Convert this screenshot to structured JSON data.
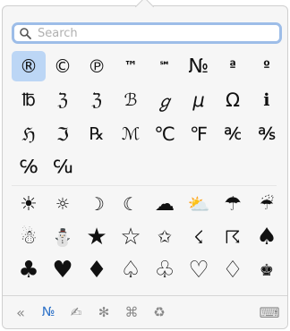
{
  "search": {
    "placeholder": "Search"
  },
  "rows": [
    [
      "®",
      "©",
      "℗",
      "™",
      "℠",
      "№",
      "ª",
      "º"
    ],
    [
      "℔",
      "ℨ",
      "ℨ",
      "ℬ",
      "ℊ",
      "μ",
      "Ω",
      "ℹ"
    ],
    [
      "ℌ",
      "ℑ",
      "℞",
      "ℳ",
      "℃",
      "℉",
      "℀",
      "℁"
    ],
    [
      "℅",
      "℆"
    ]
  ],
  "emoji_rows": [
    [
      "☀",
      "☼",
      "☽",
      "☾",
      "☁",
      "⛅",
      "☂",
      "☔"
    ],
    [
      "☃",
      "⛄",
      "★",
      "☆",
      "✩",
      "☇",
      "☈",
      "♠"
    ],
    [
      "♣",
      "♥",
      "♦",
      "♤",
      "♧",
      "♡",
      "♢",
      "♚"
    ]
  ],
  "clipped_row": [
    "♛",
    "♜",
    "♝",
    "♞",
    "♟",
    "♔",
    "♕",
    "♖"
  ],
  "selected_symbol": "®",
  "bottombar": {
    "back": "«",
    "letterlike": "№",
    "pencil": "✍",
    "asterisk": "✻",
    "command": "⌘",
    "recycle": "♻",
    "keyboard": "⌨"
  }
}
